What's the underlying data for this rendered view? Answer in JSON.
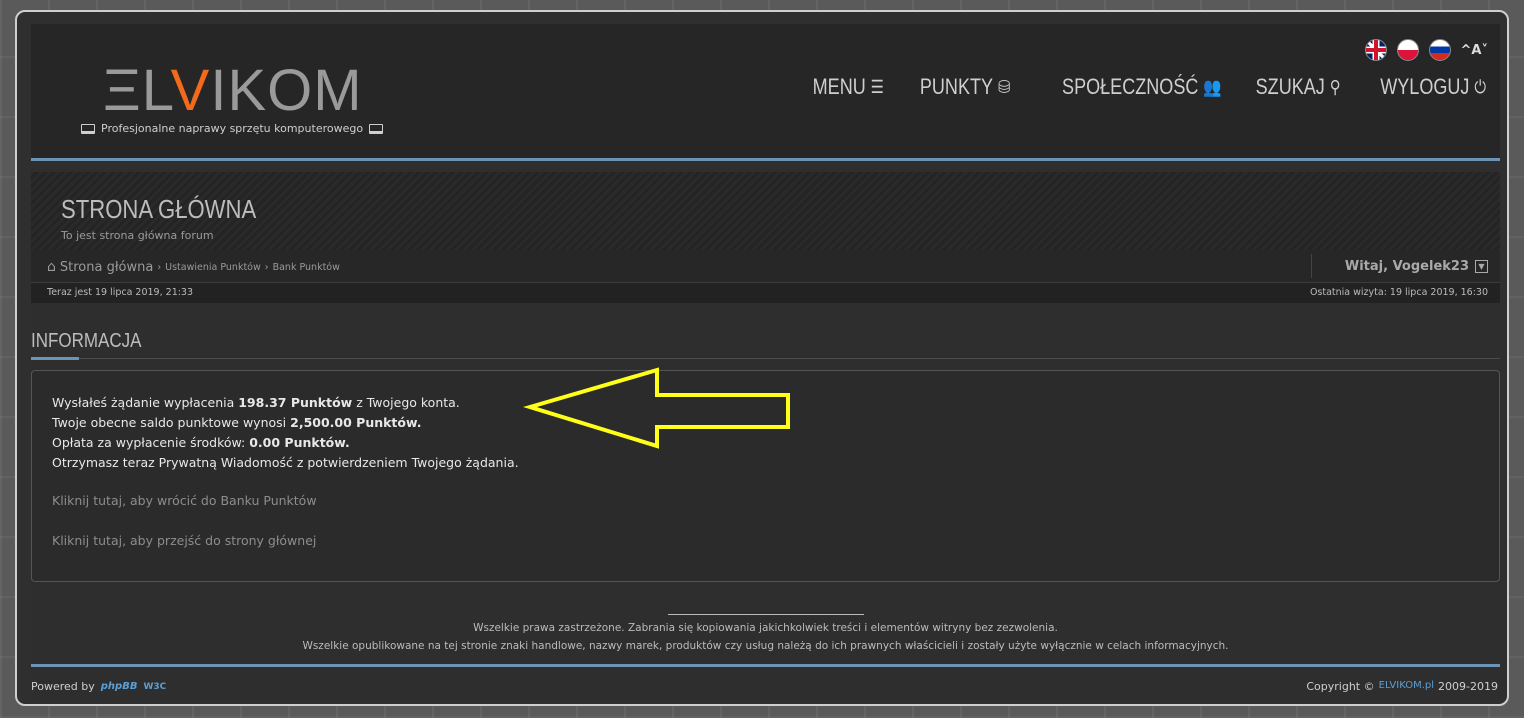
{
  "header": {
    "logo": {
      "prefix": "ΞL",
      "accent": "V",
      "suffix": "IKOM"
    },
    "tagline": "Profesjonalne naprawy sprzętu komputerowego",
    "font_toggle": "^A˅",
    "nav": [
      {
        "label": "MENU",
        "icon": "☰"
      },
      {
        "label": "PUNKTY",
        "icon": "⛁"
      },
      {
        "label": "SPOŁECZNOŚĆ",
        "icon": "👥"
      },
      {
        "label": "SZUKAJ",
        "icon": "⚲"
      },
      {
        "label": "WYLOGUJ",
        "icon": "⏻"
      }
    ]
  },
  "banner": {
    "title": "STRONA GŁÓWNA",
    "subtitle": "To jest strona główna forum"
  },
  "breadcrumb": {
    "home": "Strona główna",
    "level1": "Ustawienia Punktów",
    "level2": "Bank Punktów"
  },
  "user": {
    "welcome": "Witaj, Vogelek23"
  },
  "times": {
    "now": "Teraz jest 19 lipca 2019, 21:33",
    "last_visit": "Ostatnia wizyta: 19 lipca 2019, 16:30"
  },
  "section": {
    "title": "INFORMACJA"
  },
  "message": {
    "line1_pre": "Wysłałeś żądanie wypłacenia ",
    "line1_bold": "198.37 Punktów",
    "line1_post": " z Twojego konta.",
    "line2_pre": "Twoje obecne saldo punktowe wynosi ",
    "line2_bold": "2,500.00 Punktów.",
    "line3_pre": "Opłata za wypłacenie środków: ",
    "line3_bold": "0.00 Punktów.",
    "line4": "Otrzymasz teraz Prywatną Wiadomość z potwierdzeniem Twojego żądania.",
    "link_bank": "Kliknij tutaj, aby wrócić do Banku Punktów",
    "link_home": "Kliknij tutaj, aby przejść do strony głównej"
  },
  "footer": {
    "rights1": "Wszelkie prawa zastrzeżone. Zabrania się kopiowania jakichkolwiek treści i elementów witryny bez zezwolenia.",
    "rights2": "Wszelkie opublikowane na tej stronie znaki handlowe, nazwy marek, produktów czy usług należą do ich prawnych właścicieli i zostały użyte wyłącznie w celach informacyjnych.",
    "powered_by": "Powered by",
    "phpbb": "phpBB",
    "w3c": "W3C",
    "copyright_pre": "Copyright ©",
    "copyright_brand": "ELVIKOM.pl",
    "copyright_years": "2009-2019"
  },
  "colors": {
    "accent": "#f26a1b",
    "rule": "#6d93b6",
    "annotation": "#ffff1a"
  }
}
